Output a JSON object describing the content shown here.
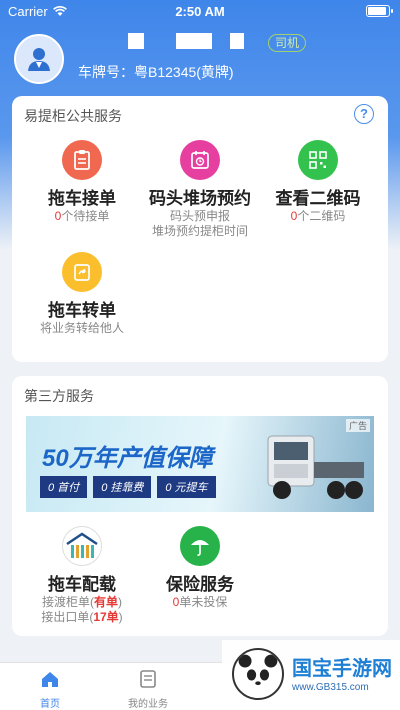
{
  "status": {
    "carrier": "Carrier",
    "time": "2:50 AM",
    "battery_level": 0.95
  },
  "profile": {
    "role_badge": "司机",
    "plate_label": "车牌号：粤B12345(黄牌)"
  },
  "public_services": {
    "title": "易提柜公共服务",
    "help": "?",
    "items": [
      {
        "name": "拖车接单",
        "count": "0",
        "sub": "个待接单",
        "color": "#f0684f",
        "icon": "clipboard-icon"
      },
      {
        "name": "码头堆场预约",
        "sub1": "码头预申报",
        "sub2": "堆场预约提柜时间",
        "color": "#e73fa0",
        "icon": "calendar-clock-icon"
      },
      {
        "name": "查看二维码",
        "count": "0",
        "sub": "个二维码",
        "color": "#32c24d",
        "icon": "qrcode-icon"
      },
      {
        "name": "拖车转单",
        "sub": "将业务转给他人",
        "color": "#fbbf2e",
        "icon": "transfer-icon"
      }
    ]
  },
  "third_party": {
    "title": "第三方服务",
    "banner": {
      "ad_label": "广告",
      "headline": "50万年产值保障",
      "chips": [
        "0 首付",
        "0 挂靠费",
        "0 元提车"
      ]
    },
    "items": [
      {
        "name": "拖车配载",
        "line1_prefix": "接渡柜单(",
        "line1_value": "有单",
        "line1_suffix": ")",
        "line2_prefix": "接出口单(",
        "line2_value": "17单",
        "line2_suffix": ")",
        "icon": "warehouse-icon"
      },
      {
        "name": "保险服务",
        "count": "0",
        "sub": "单未投保",
        "color": "#27b24a",
        "icon": "umbrella-icon"
      }
    ]
  },
  "tabbar": {
    "items": [
      {
        "label": "首页",
        "active": true,
        "icon": "home-icon",
        "color": "#3f86ea"
      },
      {
        "label": "我的业务",
        "active": false,
        "icon": "business-list-icon",
        "color": "#888888"
      }
    ]
  },
  "watermark": {
    "text": "国宝手游网",
    "url": "www.GB315.com"
  }
}
